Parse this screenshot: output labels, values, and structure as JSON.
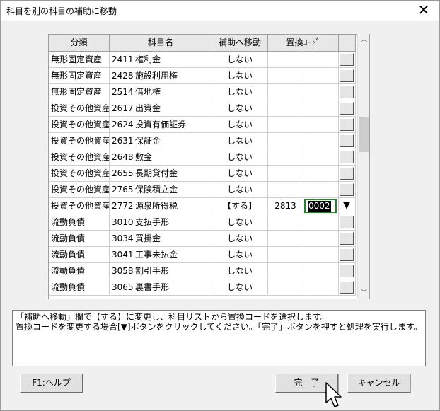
{
  "window": {
    "title": "科目を別の科目の補助に移動",
    "close_glyph": "✕"
  },
  "grid": {
    "headers": [
      "分類",
      "科目名",
      "補助へ移動",
      "置換ｺｰﾄﾞ"
    ],
    "rows": [
      {
        "category": "無形固定資産",
        "code": "2411",
        "name": "権利金",
        "move": "しない",
        "rep_code": "",
        "rep_value": "",
        "editing": false
      },
      {
        "category": "無形固定資産",
        "code": "2428",
        "name": "施設利用権",
        "move": "しない",
        "rep_code": "",
        "rep_value": "",
        "editing": false
      },
      {
        "category": "無形固定資産",
        "code": "2514",
        "name": "借地権",
        "move": "しない",
        "rep_code": "",
        "rep_value": "",
        "editing": false
      },
      {
        "category": "投資その他資産",
        "code": "2617",
        "name": "出資金",
        "move": "しない",
        "rep_code": "",
        "rep_value": "",
        "editing": false
      },
      {
        "category": "投資その他資産",
        "code": "2624",
        "name": "投資有価証券",
        "move": "しない",
        "rep_code": "",
        "rep_value": "",
        "editing": false
      },
      {
        "category": "投資その他資産",
        "code": "2631",
        "name": "保証金",
        "move": "しない",
        "rep_code": "",
        "rep_value": "",
        "editing": false
      },
      {
        "category": "投資その他資産",
        "code": "2648",
        "name": "敷金",
        "move": "しない",
        "rep_code": "",
        "rep_value": "",
        "editing": false
      },
      {
        "category": "投資その他資産",
        "code": "2655",
        "name": "長期貸付金",
        "move": "しない",
        "rep_code": "",
        "rep_value": "",
        "editing": false
      },
      {
        "category": "投資その他資産",
        "code": "2765",
        "name": "保険積立金",
        "move": "しない",
        "rep_code": "",
        "rep_value": "",
        "editing": false
      },
      {
        "category": "投資その他資産",
        "code": "2772",
        "name": "源泉所得税",
        "move": "【する】",
        "rep_code": "2813",
        "rep_value": "0002",
        "editing": true
      },
      {
        "category": "流動負債",
        "code": "3010",
        "name": "支払手形",
        "move": "しない",
        "rep_code": "",
        "rep_value": "",
        "editing": false
      },
      {
        "category": "流動負債",
        "code": "3034",
        "name": "買掛金",
        "move": "しない",
        "rep_code": "",
        "rep_value": "",
        "editing": false
      },
      {
        "category": "流動負債",
        "code": "3041",
        "name": "工事未払金",
        "move": "しない",
        "rep_code": "",
        "rep_value": "",
        "editing": false
      },
      {
        "category": "流動負債",
        "code": "3058",
        "name": "割引手形",
        "move": "しない",
        "rep_code": "",
        "rep_value": "",
        "editing": false
      },
      {
        "category": "流動負債",
        "code": "3065",
        "name": "裏書手形",
        "move": "しない",
        "rep_code": "",
        "rep_value": "",
        "editing": false
      }
    ],
    "dropdown_glyph": "▼"
  },
  "scrollbar": {
    "up_glyph": "︿",
    "down_glyph": "﹀"
  },
  "message": {
    "line1": "「補助へ移動」欄で【する】に変更し、科目リストから置換コードを選択します。",
    "line2": "置換コードを変更する場合[▼]ボタンをクリックしてください。「完了」ボタンを押すと処理を実行します。"
  },
  "buttons": {
    "help": "F1:ヘルプ",
    "done": "完　了",
    "cancel": "キャンセル"
  }
}
